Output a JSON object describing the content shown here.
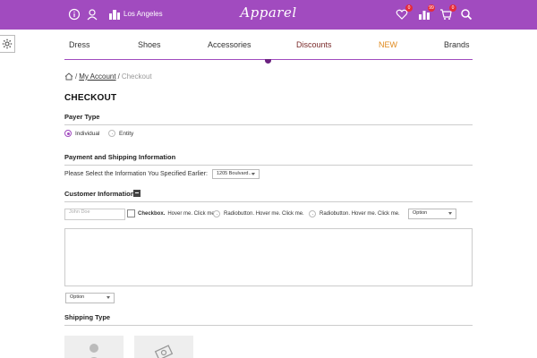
{
  "header": {
    "city": "Los Angeles",
    "logo": "Apparel",
    "wishlist_count": "0",
    "compare_count": "99",
    "cart_count": "0",
    "color": "#a14bbf",
    "icons": [
      "info-icon",
      "user-icon",
      "city-icon",
      "heart-icon",
      "compare-icon",
      "cart-icon",
      "search-icon"
    ]
  },
  "nav": {
    "items": [
      {
        "label": "Dress"
      },
      {
        "label": "Shoes"
      },
      {
        "label": "Accessories"
      },
      {
        "label": "Discounts"
      },
      {
        "label": "NEW"
      },
      {
        "label": "Brands"
      }
    ]
  },
  "breadcrumb": {
    "account": "My Account",
    "current": "Checkout",
    "sep": "/"
  },
  "page": {
    "title": "CHECKOUT"
  },
  "payer": {
    "heading": "Payer Type",
    "options": [
      "Individual",
      "Entity"
    ],
    "selected": "Individual"
  },
  "payment": {
    "heading": "Payment and Shipping Information",
    "prompt": "Please Select the Information You Specified Earlier:",
    "address_value": "1205 Boulvard..."
  },
  "customer": {
    "heading": "Customer Information",
    "name_placeholder": "John Doe",
    "checkbox_bold": "Checkbox.",
    "checkbox_text": "Hover me. Click me.",
    "radio1": "Radiobutton. Hover me. Click me.",
    "radio2": "Radiobutton. Hover me. Click me.",
    "option1": "Option",
    "option2": "Option"
  },
  "shipping": {
    "heading": "Shipping Type",
    "cards": [
      "person-icon",
      "money-icon"
    ]
  }
}
